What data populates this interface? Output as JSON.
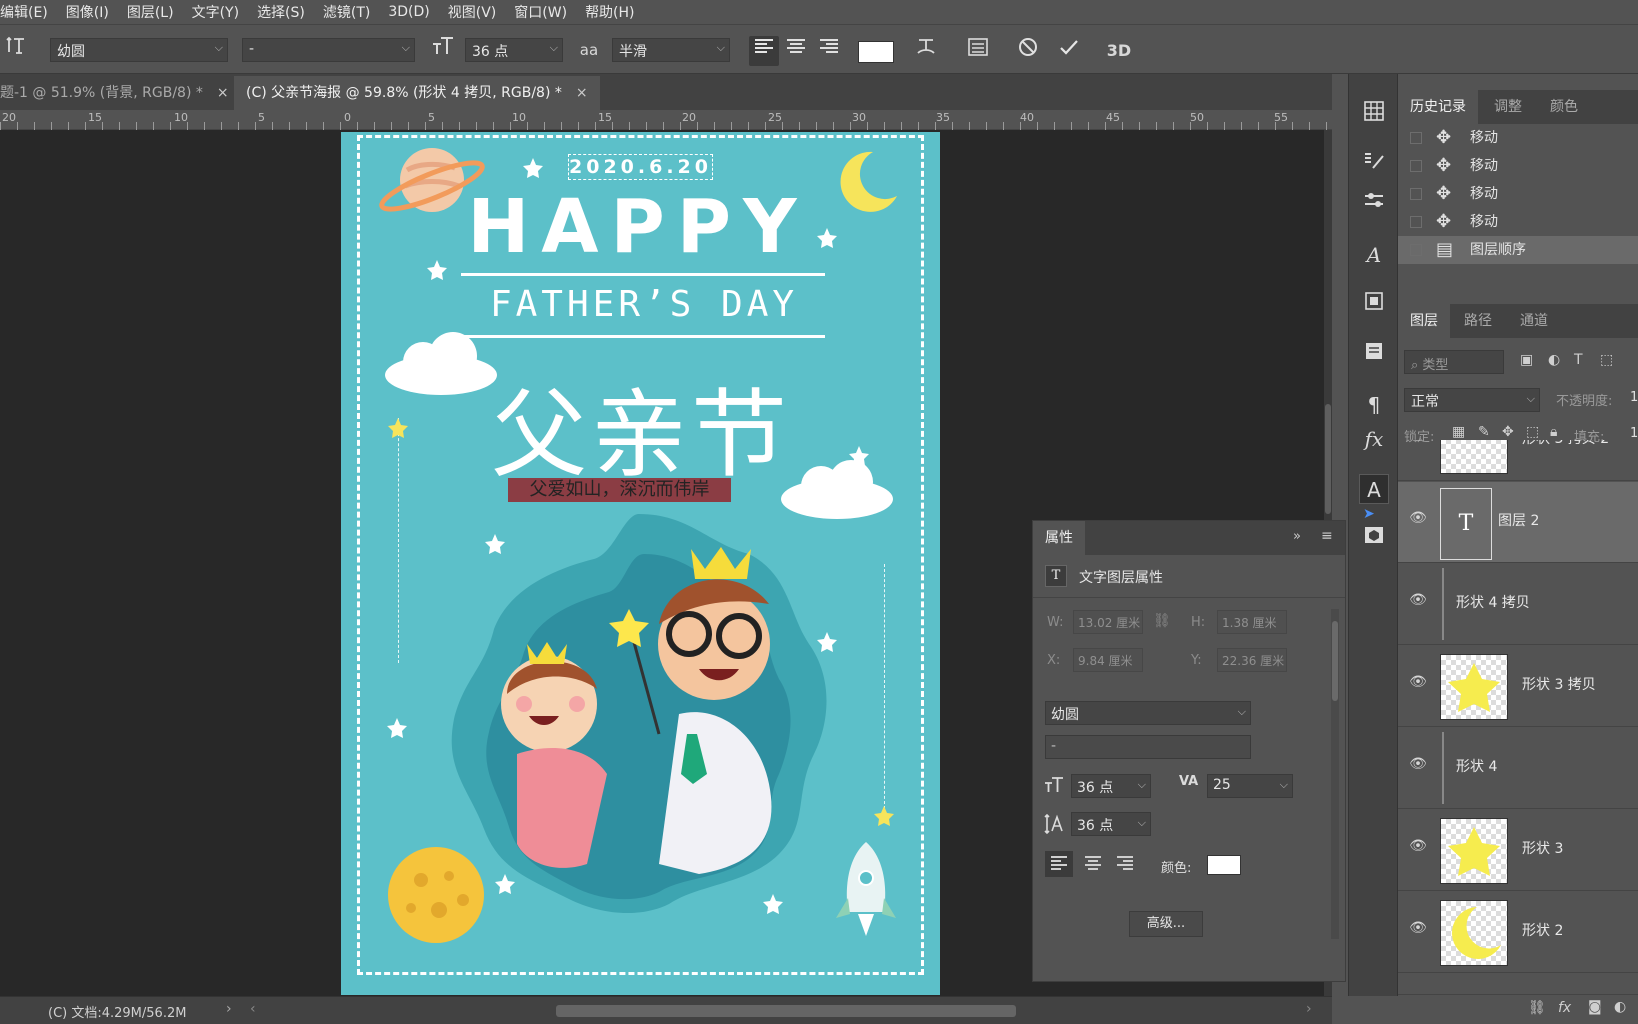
{
  "menubar": {
    "items": [
      "编辑(E)",
      "图像(I)",
      "图层(L)",
      "文字(Y)",
      "选择(S)",
      "滤镜(T)",
      "3D(D)",
      "视图(V)",
      "窗口(W)",
      "帮助(H)"
    ]
  },
  "options": {
    "font_family": "幼圆",
    "font_style": "-",
    "font_size": "36 点",
    "antialias": "半滑",
    "text_color": "#ffffff",
    "threed_label": "3D"
  },
  "tabs": [
    {
      "label": "题-1 @ 51.9% (背景, RGB/8) *",
      "close": "×"
    },
    {
      "label": "(C) 父亲节海报 @ 59.8% (形状 4 拷贝, RGB/8) *",
      "close": "×"
    }
  ],
  "ruler": {
    "labels": [
      "20",
      "15",
      "10",
      "5",
      "0",
      "5",
      "10",
      "15",
      "20",
      "25",
      "30",
      "35",
      "40",
      "45",
      "50",
      "55"
    ]
  },
  "poster": {
    "date": "2020.6.20",
    "happy": "HAPPY",
    "fathers_day": "FATHER’S DAY",
    "cn_title": "父亲节",
    "subtitle": "父爱如山，深沉而伟岸",
    "bg_color": "#5cc0c9"
  },
  "history": {
    "tabs": [
      "历史记录",
      "调整",
      "颜色"
    ],
    "items": [
      "移动",
      "移动",
      "移动",
      "移动",
      "图层顺序"
    ]
  },
  "layers": {
    "tabs": [
      "图层",
      "路径",
      "通道"
    ],
    "filter_placeholder": "类型",
    "blend_mode": "正常",
    "opacity_label": "不透明度:",
    "opacity_value": "1",
    "lock_label": "锁定:",
    "fill_label": "填充:",
    "fill_value": "1",
    "items": [
      {
        "name": "形状 3 拷贝 2"
      },
      {
        "name": "图层 2"
      },
      {
        "name": "形状 4 拷贝"
      },
      {
        "name": "形状 3 拷贝"
      },
      {
        "name": "形状 4"
      },
      {
        "name": "形状 3"
      },
      {
        "name": "形状 2"
      }
    ]
  },
  "properties": {
    "title": "属性",
    "type_label": "文字图层属性",
    "w_label": "W:",
    "w_value": "13.02 厘米",
    "h_label": "H:",
    "h_value": "1.38 厘米",
    "x_label": "X:",
    "x_value": "9.84 厘米",
    "y_label": "Y:",
    "y_value": "22.36 厘米",
    "font_family": "幼圆",
    "font_style": "-",
    "font_size": "36 点",
    "tracking": "25",
    "leading": "36 点",
    "color_label": "颜色:",
    "color_value": "#ffffff",
    "advanced_button": "高级..."
  },
  "status": {
    "doc_info": "(C) 文档:4.29M/56.2M"
  }
}
